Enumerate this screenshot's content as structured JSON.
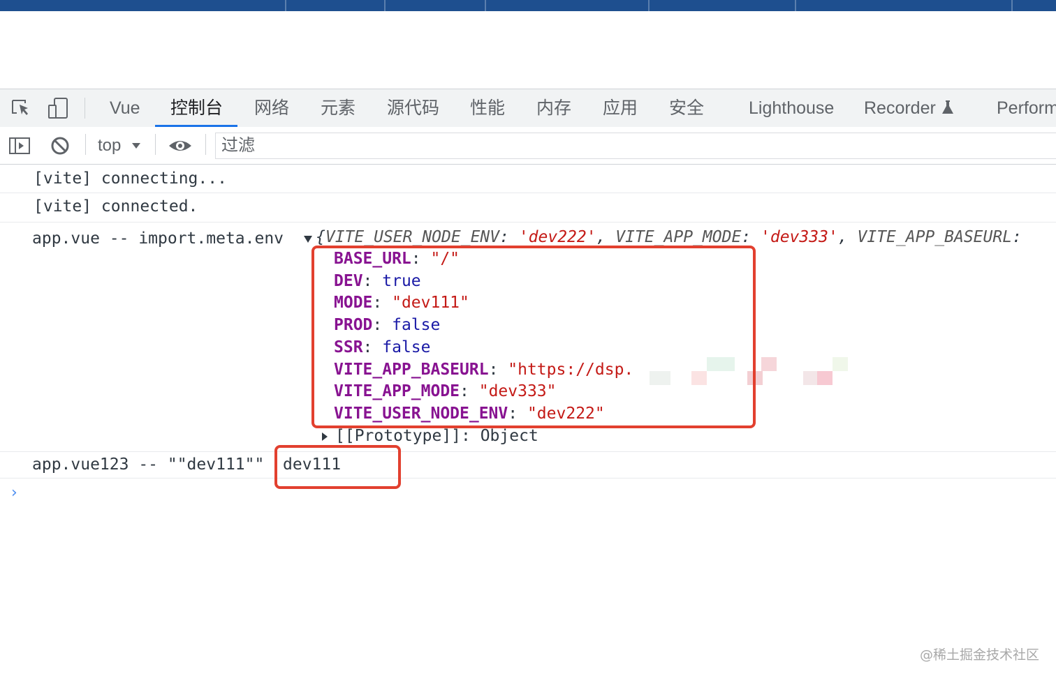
{
  "tabs": [
    {
      "label": "Vue"
    },
    {
      "label": "控制台"
    },
    {
      "label": "网络"
    },
    {
      "label": "元素"
    },
    {
      "label": "源代码"
    },
    {
      "label": "性能"
    },
    {
      "label": "内存"
    },
    {
      "label": "应用"
    },
    {
      "label": "安全"
    },
    {
      "label": "Lighthouse"
    },
    {
      "label": "Recorder"
    },
    {
      "label": "Perform"
    }
  ],
  "active_tab": "控制台",
  "toolbar": {
    "context_label": "top",
    "filter_placeholder": "过滤"
  },
  "console": {
    "line1": "[vite] connecting...",
    "line2": "[vite] connected.",
    "log1_prefix": "app.vue -- import.meta.env",
    "preview": {
      "k1": "VITE_USER_NODE_ENV",
      "v1": "'dev222'",
      "k2": "VITE_APP_MODE",
      "v2": "'dev333'",
      "k3": "VITE_APP_BASEURL"
    },
    "props": [
      {
        "key": "BASE_URL",
        "value": "\"/\"",
        "type": "string"
      },
      {
        "key": "DEV",
        "value": "true",
        "type": "keyword"
      },
      {
        "key": "MODE",
        "value": "\"dev111\"",
        "type": "string"
      },
      {
        "key": "PROD",
        "value": "false",
        "type": "keyword"
      },
      {
        "key": "SSR",
        "value": "false",
        "type": "keyword"
      },
      {
        "key": "VITE_APP_BASEURL",
        "value": "\"https://dsp.",
        "type": "string"
      },
      {
        "key": "VITE_APP_MODE",
        "value": "\"dev333\"",
        "type": "string"
      },
      {
        "key": "VITE_USER_NODE_ENV",
        "value": "\"dev222\"",
        "type": "string"
      }
    ],
    "prototype": "[[Prototype]]: Object",
    "log2_prefix": "app.vue123 -- \"\"dev111\"\"",
    "log2_value": "dev111",
    "prompt": "›"
  },
  "colors": {
    "accent": "#1a73e8",
    "highlight_box": "#e2402f",
    "key": "#881391",
    "string": "#c41a16",
    "keyword": "#1a1aa6"
  },
  "watermark": "@稀土掘金技术社区"
}
